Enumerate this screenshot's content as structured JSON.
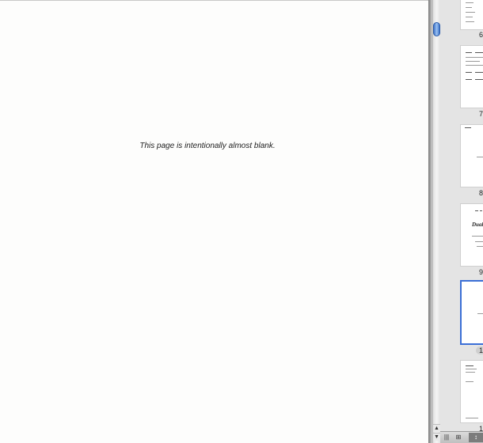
{
  "document": {
    "page_text": "This page is intentionally almost blank."
  },
  "thumbnails": [
    {
      "number": "6",
      "dual_title": ""
    },
    {
      "number": "7",
      "dual_title": ""
    },
    {
      "number": "8",
      "dual_title": ""
    },
    {
      "number": "9",
      "dual_title": "Dual"
    },
    {
      "number": "1",
      "dual_title": ""
    },
    {
      "number": "1",
      "dual_title": ""
    }
  ],
  "scrollbar": {
    "up_arrow": "▲",
    "down_arrow": "▼"
  },
  "bottom_bar": {
    "columns_icon": "|||",
    "grid_icon": "⊞",
    "sort_icon": "↕"
  }
}
